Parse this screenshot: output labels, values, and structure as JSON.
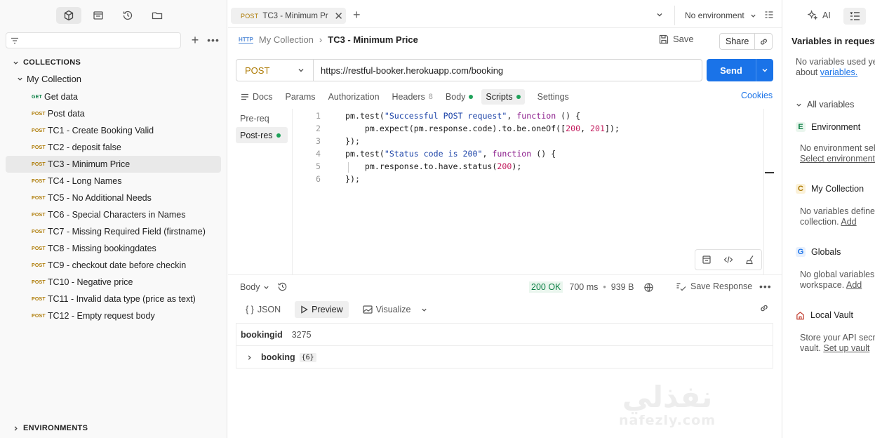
{
  "colors": {
    "accent": "#1a73e8",
    "post": "#ad7a03",
    "get": "#0a7f44",
    "ok": "#0a7f44"
  },
  "sidebar": {
    "collections_label": "COLLECTIONS",
    "environments_label": "ENVIRONMENTS",
    "collection_name": "My Collection",
    "items": [
      {
        "method": "GET",
        "name": "Get data"
      },
      {
        "method": "POST",
        "name": "Post data"
      },
      {
        "method": "POST",
        "name": "TC1 - Create Booking Valid"
      },
      {
        "method": "POST",
        "name": "TC2 - deposit false"
      },
      {
        "method": "POST",
        "name": "TC3 - Minimum Price"
      },
      {
        "method": "POST",
        "name": "TC4 - Long Names"
      },
      {
        "method": "POST",
        "name": "TC5 - No Additional Needs"
      },
      {
        "method": "POST",
        "name": "TC6 - Special Characters in Names"
      },
      {
        "method": "POST",
        "name": "TC7 - Missing Required Field (firstname)"
      },
      {
        "method": "POST",
        "name": "TC8 - Missing bookingdates"
      },
      {
        "method": "POST",
        "name": "TC9 - checkout date before checkin"
      },
      {
        "method": "POST",
        "name": "TC10 - Negative price"
      },
      {
        "method": "POST",
        "name": "TC11 - Invalid data type (price as text)"
      },
      {
        "method": "POST",
        "name": "TC12 - Empty request body"
      }
    ]
  },
  "tab": {
    "method": "POST",
    "name": "TC3 - Minimum Pr"
  },
  "environment": {
    "selected": "No environment"
  },
  "breadcrumb": {
    "protocol": "HTTP",
    "collection": "My Collection",
    "request": "TC3 - Minimum Price"
  },
  "toolbar": {
    "save_label": "Save",
    "share_label": "Share"
  },
  "request": {
    "method": "POST",
    "url": "https://restful-booker.herokuapp.com/booking",
    "send_label": "Send",
    "tabs": [
      {
        "label": "Docs"
      },
      {
        "label": "Params"
      },
      {
        "label": "Authorization"
      },
      {
        "label": "Headers",
        "count": "8"
      },
      {
        "label": "Body"
      },
      {
        "label": "Scripts"
      },
      {
        "label": "Settings"
      }
    ],
    "cookies_label": "Cookies"
  },
  "scripts": {
    "sides": [
      "Pre-req",
      "Post-res"
    ],
    "line_numbers": [
      "1",
      "2",
      "3",
      "4",
      "5",
      "6"
    ]
  },
  "response": {
    "body_label": "Body",
    "status": "200 OK",
    "time": "700 ms",
    "size": "939 B",
    "save_label": "Save Response",
    "formats": [
      "JSON",
      "Preview",
      "Visualize"
    ],
    "rows": [
      {
        "key": "bookingid",
        "value": "3275"
      },
      {
        "key": "booking",
        "badge": "{6}"
      }
    ]
  },
  "watermark": {
    "arabic": "نفذلي",
    "latin": "nafezly.com"
  },
  "right_panel": {
    "ai_label": "AI",
    "title": "Variables in request",
    "empty_line1": "No variables used yet",
    "empty_line2_pre": "about ",
    "empty_line2_link": "variables.",
    "all_variables": "All variables",
    "environment": {
      "letter": "E",
      "label": "Environment",
      "line1": "No environment selected.",
      "line2_link": "Select environment"
    },
    "collection": {
      "letter": "C",
      "label": "My Collection",
      "line1": "No variables defined in this",
      "line2_pre": "collection. ",
      "line2_link": "Add"
    },
    "globals": {
      "letter": "G",
      "label": "Globals",
      "line1": "No global variables in this",
      "line2_pre": "workspace. ",
      "line2_link": "Add"
    },
    "vault": {
      "label": "Local Vault",
      "line1": "Store your API secrets in",
      "line2_pre": "vault. ",
      "line2_link": "Set up vault"
    }
  }
}
